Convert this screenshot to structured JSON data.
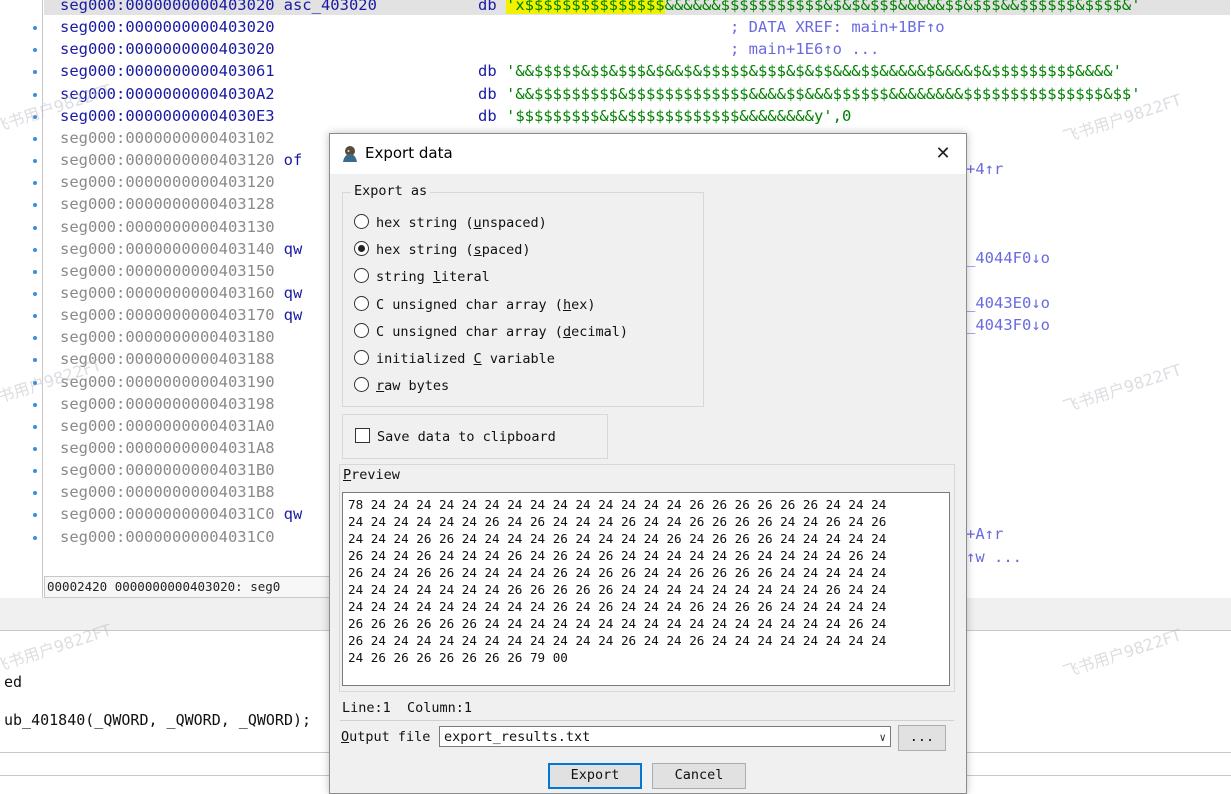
{
  "disasm": {
    "lines": [
      {
        "addr": "seg000:0000000000403020",
        "rest": "asc_403020",
        "db": "db ",
        "str_hl": "'x$$$$$$$$$$$$$$$",
        "str_rest": "&&&&&&$$$$$$$$$$$&$&$&$$$&&&&&$$&$$$&&$$$$$$&$$$$&'"
      },
      {
        "addr": "seg000:0000000000403020",
        "comment": "; DATA XREF: main+1BF↑o"
      },
      {
        "addr": "seg000:0000000000403020",
        "comment": "; main+1E6↑o ..."
      },
      {
        "addr": "seg000:0000000000403061",
        "db": "db ",
        "str": "'&&$$$$$&$$&$$$&$&&$&$$$$$&$$$&$&$$&&&$$&&&&&$&&&&$&$$$$$$$$$&&&&'"
      },
      {
        "addr": "seg000:00000000004030A2",
        "db": "db ",
        "str": "'&&$$$$$$$$$&$$$$$$$$$$$$$&&&&$$&&&$$$$$$&&&&&&&&$$$$$$$$$$$$$$$&$$'"
      },
      {
        "addr": "seg000:00000000004030E3",
        "db": "db ",
        "str": "'$$$$$$$$$&$&$$$$$$$$$$$$&&&&&&&&y',0"
      },
      {
        "addr": "seg000:0000000000403102"
      },
      {
        "addr": "seg000:0000000000403120",
        "rest": "of"
      },
      {
        "addr": "seg000:0000000000403120"
      },
      {
        "addr": "seg000:0000000000403128"
      },
      {
        "addr": "seg000:0000000000403130"
      },
      {
        "addr": "seg000:0000000000403140",
        "rest": "qw"
      },
      {
        "addr": "seg000:0000000000403150"
      },
      {
        "addr": "seg000:0000000000403160",
        "rest": "qw"
      },
      {
        "addr": "seg000:0000000000403170",
        "rest": "qw"
      },
      {
        "addr": "seg000:0000000000403180"
      },
      {
        "addr": "seg000:0000000000403188"
      },
      {
        "addr": "seg000:0000000000403190"
      },
      {
        "addr": "seg000:0000000000403198"
      },
      {
        "addr": "seg000:00000000004031A0"
      },
      {
        "addr": "seg000:00000000004031A8"
      },
      {
        "addr": "seg000:00000000004031B0"
      },
      {
        "addr": "seg000:00000000004031B8"
      },
      {
        "addr": "seg000:00000000004031C0",
        "rest": "qw"
      },
      {
        "addr": "seg000:00000000004031C0"
      }
    ],
    "xrefs": [
      "+4↑r",
      "_4044F0↓o",
      "_4043E0↓o",
      "_4043F0↓o",
      "+A↑r",
      "↑w ..."
    ],
    "status_line": "00002420 0000000000403020: seg0"
  },
  "lower": {
    "line1": "ed",
    "line2": "ub_401840(_QWORD, _QWORD, _QWORD);"
  },
  "watermark": "飞书用户9822FT",
  "dialog": {
    "title": "Export data",
    "close_glyph": "✕",
    "export_as_label": "Export as",
    "options": [
      {
        "pre": "hex string (",
        "key": "u",
        "post": "nspaced)",
        "selected": false
      },
      {
        "pre": "hex string (",
        "key": "s",
        "post": "paced)",
        "selected": true
      },
      {
        "pre": "string ",
        "key": "l",
        "post": "iteral",
        "selected": false
      },
      {
        "pre": "C unsigned char array (",
        "key": "h",
        "post": "ex)",
        "selected": false
      },
      {
        "pre": "C unsigned char array (",
        "key": "d",
        "post": "ecimal)",
        "selected": false
      },
      {
        "pre": "initialized ",
        "key": "C",
        "post": " variable",
        "selected": false
      },
      {
        "pre": "",
        "key": "r",
        "post": "aw bytes",
        "selected": false
      }
    ],
    "clipboard_label": "Save data to clipboard",
    "preview_label_key": "P",
    "preview_label_rest": "review",
    "preview_lines": [
      "78 24 24 24 24 24 24 24 24 24 24 24 24 24 24 26 26 26 26 26 26 24 24 24",
      "24 24 24 24 24 24 26 24 26 24 24 24 26 24 24 26 26 26 26 24 24 26 24 26",
      "24 24 24 26 26 24 24 24 24 26 24 24 24 24 26 24 26 26 26 24 24 24 24 24",
      "26 24 24 26 24 24 24 26 24 26 24 26 24 24 24 24 24 26 24 24 24 24 26 24",
      "26 24 24 26 26 24 24 24 24 26 24 26 26 24 24 26 26 26 26 24 24 24 24 24",
      "24 24 24 24 24 24 24 26 26 26 26 26 24 24 24 24 24 24 24 24 24 26 24 24",
      "24 24 24 24 24 24 24 24 24 26 24 26 24 24 24 26 24 26 26 24 24 24 24 24",
      "26 26 26 26 26 26 24 24 24 24 24 24 24 24 24 24 24 24 24 24 24 24 26 24",
      "26 24 24 24 24 24 24 24 24 24 24 24 26 24 24 26 24 24 24 24 24 24 24 24",
      "24 26 26 26 26 26 26 26 79 00"
    ],
    "line_col": "Line:1  Column:1",
    "output_key": "O",
    "output_rest": "utput file",
    "output_value": "export_results.txt",
    "browse_label": "...",
    "export_label": "Export",
    "cancel_label": "Cancel"
  }
}
